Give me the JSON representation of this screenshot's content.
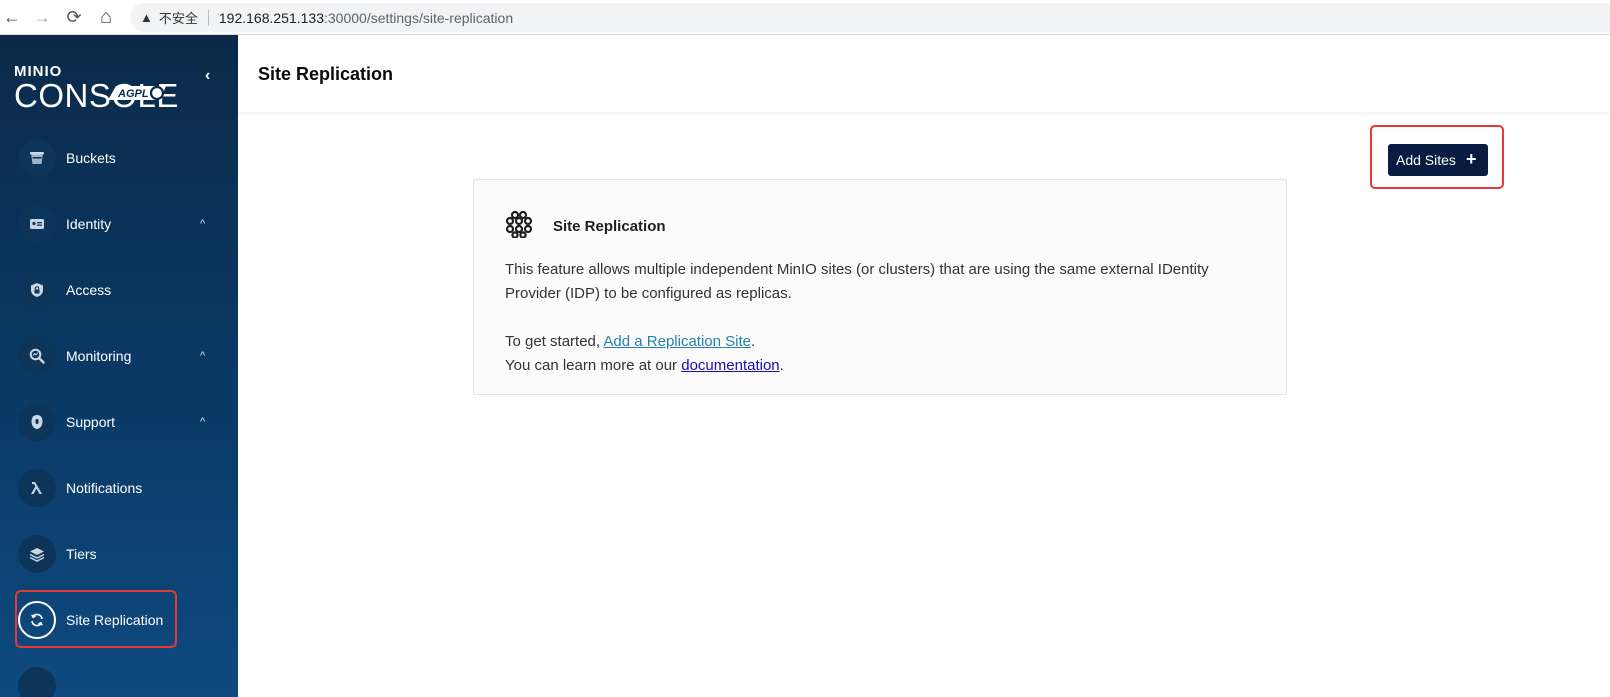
{
  "browser": {
    "back_icon": "←",
    "forward_icon": "→",
    "reload_icon": "⟳",
    "home_icon": "⌂",
    "warning_icon": "▲",
    "insecure_label": "不安全",
    "url_host": "192.168.251.133",
    "url_path": ":30000/settings/site-replication"
  },
  "sidebar": {
    "logo": {
      "brand": "MINIO",
      "product": "CONSOLE",
      "license": "AGPL v3"
    },
    "collapse_icon": "‹",
    "items": [
      {
        "label": "Buckets",
        "icon": "bucket-icon",
        "expandable": false
      },
      {
        "label": "Identity",
        "icon": "id-card-icon",
        "expandable": true
      },
      {
        "label": "Access",
        "icon": "shield-lock-icon",
        "expandable": false
      },
      {
        "label": "Monitoring",
        "icon": "search-chart-icon",
        "expandable": true
      },
      {
        "label": "Support",
        "icon": "support-icon",
        "expandable": true
      },
      {
        "label": "Notifications",
        "icon": "lambda-icon",
        "expandable": false
      },
      {
        "label": "Tiers",
        "icon": "layers-icon",
        "expandable": false
      },
      {
        "label": "Site Replication",
        "icon": "sync-icon",
        "expandable": false,
        "active": true
      }
    ],
    "chevron": "^"
  },
  "header": {
    "title": "Site Replication"
  },
  "actions": {
    "add_sites_label": "Add Sites",
    "plus_icon": "+"
  },
  "card": {
    "title": "Site Replication",
    "description": "This feature allows multiple independent MinIO sites (or clusters) that are using the same external IDentity Provider (IDP) to be configured as replicas.",
    "started_prefix": "To get started, ",
    "started_link": "Add a Replication Site",
    "started_suffix": ".",
    "learn_prefix": "You can learn more at our ",
    "learn_link": "documentation",
    "learn_suffix": "."
  },
  "colors": {
    "sidebar_top": "#0b2a4a",
    "sidebar_bottom": "#0f4a80",
    "button_bg": "#081c42",
    "highlight": "#e53935",
    "link": "#2781b0"
  }
}
